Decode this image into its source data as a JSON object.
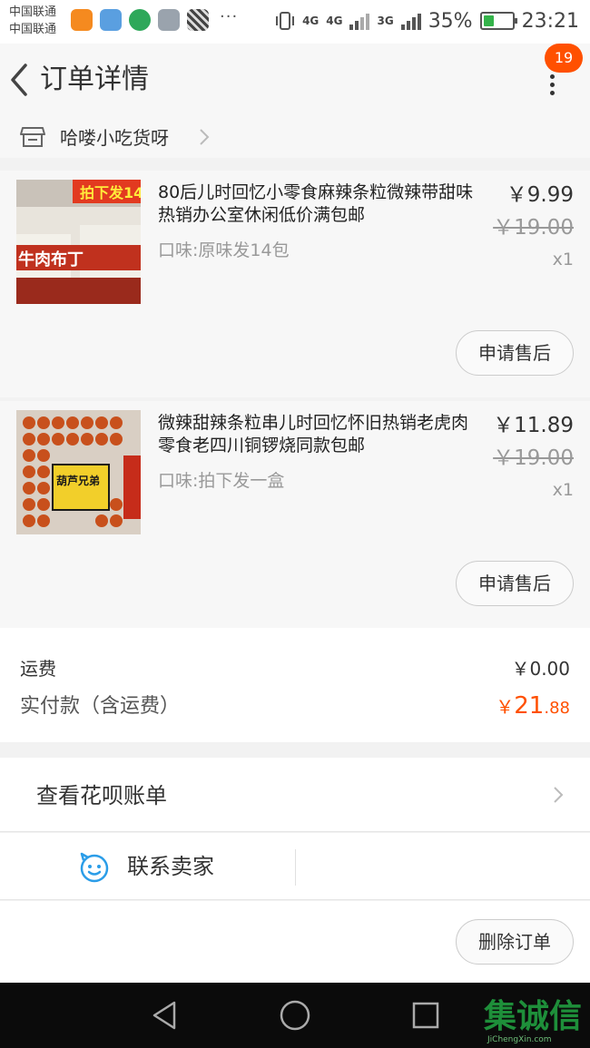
{
  "status_bar": {
    "carrier_line1": "中国联通",
    "carrier_line2": "中国联通",
    "dots": "···",
    "network_1": "4G",
    "network_2": "4G",
    "network_3": "3G",
    "battery_percent": "35%",
    "battery_level": 0.35,
    "time": "23:21"
  },
  "header": {
    "title": "订单详情",
    "badge_count": "19",
    "icons": {
      "back": "chevron-left-icon",
      "more": "more-vertical-icon"
    }
  },
  "shop": {
    "name": "哈喽小吃货呀",
    "icon": "store-icon"
  },
  "items": [
    {
      "title": "80后儿时回忆小零食麻辣条粒微辣带甜味热销办公室休闲低价满包邮",
      "spec": "口味:原味发14包",
      "price": "￥9.99",
      "original_price": "￥19.00",
      "quantity": "x1",
      "after_sale_label": "申请售后",
      "thumb_text": "拍下发14",
      "thumb_label": "牛肉布丁"
    },
    {
      "title": "微辣甜辣条粒串儿时回忆怀旧热销老虎肉零食老四川铜锣烧同款包邮",
      "spec": "口味:拍下发一盒",
      "price": "￥11.89",
      "original_price": "￥19.00",
      "quantity": "x1",
      "after_sale_label": "申请售后",
      "thumb_text": "葫芦兄弟"
    }
  ],
  "summary": {
    "shipping_label": "运费",
    "shipping_value": "￥0.00",
    "paid_label": "实付款（含运费）",
    "paid_currency": "￥",
    "paid_integer": "21",
    "paid_decimal": ".88",
    "accent_color": "#ff5000"
  },
  "actions": {
    "huabei_label": "查看花呗账单",
    "contact_label": "联系卖家",
    "delete_label": "删除订单"
  },
  "watermark": {
    "text": "集诚信",
    "sub": "JiChengXin.com"
  }
}
